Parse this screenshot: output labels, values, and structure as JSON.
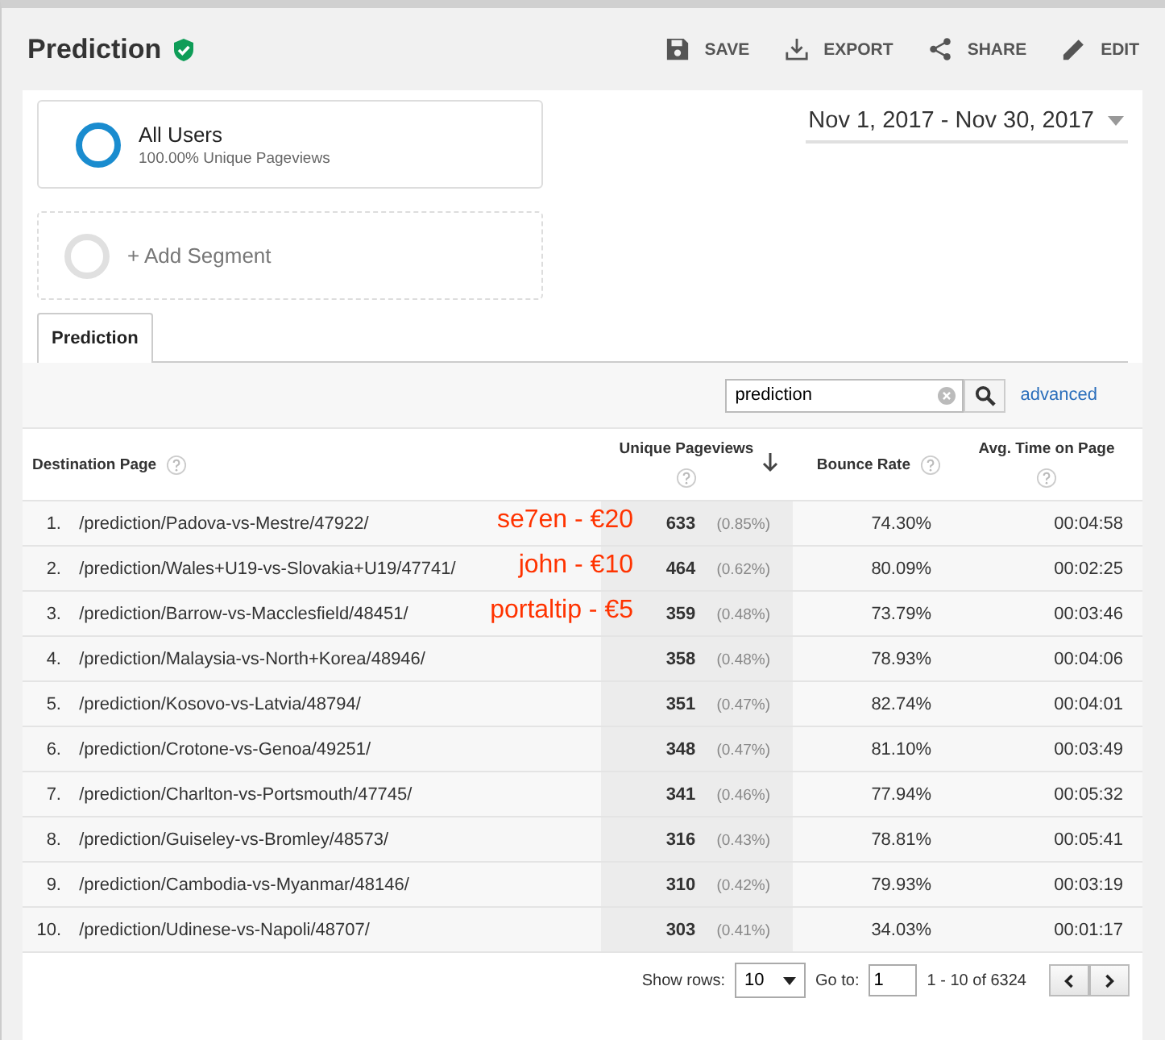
{
  "title": "Prediction",
  "verified": true,
  "actions": [
    {
      "kind": "save",
      "label": "SAVE"
    },
    {
      "kind": "export",
      "label": "EXPORT"
    },
    {
      "kind": "share",
      "label": "SHARE"
    },
    {
      "kind": "edit",
      "label": "EDIT"
    }
  ],
  "segment": {
    "name": "All Users",
    "detail": "100.00% Unique Pageviews"
  },
  "add_segment": "+ Add Segment",
  "date_range": "Nov 1, 2017 - Nov 30, 2017",
  "tabs": [
    {
      "label": "Prediction",
      "selected": true
    }
  ],
  "filter": {
    "value": "prediction",
    "advanced": "advanced"
  },
  "columns": [
    {
      "label": "Destination Page",
      "sorted": false
    },
    {
      "label": "Unique Pageviews",
      "sorted": true
    },
    {
      "label": "Bounce Rate",
      "sorted": false
    },
    {
      "label": "Avg. Time on Page",
      "sorted": false
    }
  ],
  "rows": [
    {
      "index": "1.",
      "page": "/prediction/Padova-vs-Mestre/47922/",
      "annotation": "se7en - €20",
      "views": "633",
      "share": "(0.85%)",
      "bounce": "74.30%",
      "time": "00:04:58"
    },
    {
      "index": "2.",
      "page": "/prediction/Wales+U19-vs-Slovakia+U19/47741/",
      "annotation": "john  - €10",
      "views": "464",
      "share": "(0.62%)",
      "bounce": "80.09%",
      "time": "00:02:25"
    },
    {
      "index": "3.",
      "page": "/prediction/Barrow-vs-Macclesfield/48451/",
      "annotation": "portaltip - €5",
      "views": "359",
      "share": "(0.48%)",
      "bounce": "73.79%",
      "time": "00:03:46"
    },
    {
      "index": "4.",
      "page": "/prediction/Malaysia-vs-North+Korea/48946/",
      "views": "358",
      "share": "(0.48%)",
      "bounce": "78.93%",
      "time": "00:04:06"
    },
    {
      "index": "5.",
      "page": "/prediction/Kosovo-vs-Latvia/48794/",
      "views": "351",
      "share": "(0.47%)",
      "bounce": "82.74%",
      "time": "00:04:01"
    },
    {
      "index": "6.",
      "page": "/prediction/Crotone-vs-Genoa/49251/",
      "views": "348",
      "share": "(0.47%)",
      "bounce": "81.10%",
      "time": "00:03:49"
    },
    {
      "index": "7.",
      "page": "/prediction/Charlton-vs-Portsmouth/47745/",
      "views": "341",
      "share": "(0.46%)",
      "bounce": "77.94%",
      "time": "00:05:32"
    },
    {
      "index": "8.",
      "page": "/prediction/Guiseley-vs-Bromley/48573/",
      "views": "316",
      "share": "(0.43%)",
      "bounce": "78.81%",
      "time": "00:05:41"
    },
    {
      "index": "9.",
      "page": "/prediction/Cambodia-vs-Myanmar/48146/",
      "views": "310",
      "share": "(0.42%)",
      "bounce": "79.93%",
      "time": "00:03:19"
    },
    {
      "index": "10.",
      "page": "/prediction/Udinese-vs-Napoli/48707/",
      "views": "303",
      "share": "(0.41%)",
      "bounce": "34.03%",
      "time": "00:01:17"
    }
  ],
  "pager": {
    "show_rows_label": "Show rows:",
    "show_rows": "10",
    "goto_label": "Go to:",
    "goto": "1",
    "range": "1 - 10 of 6324"
  }
}
